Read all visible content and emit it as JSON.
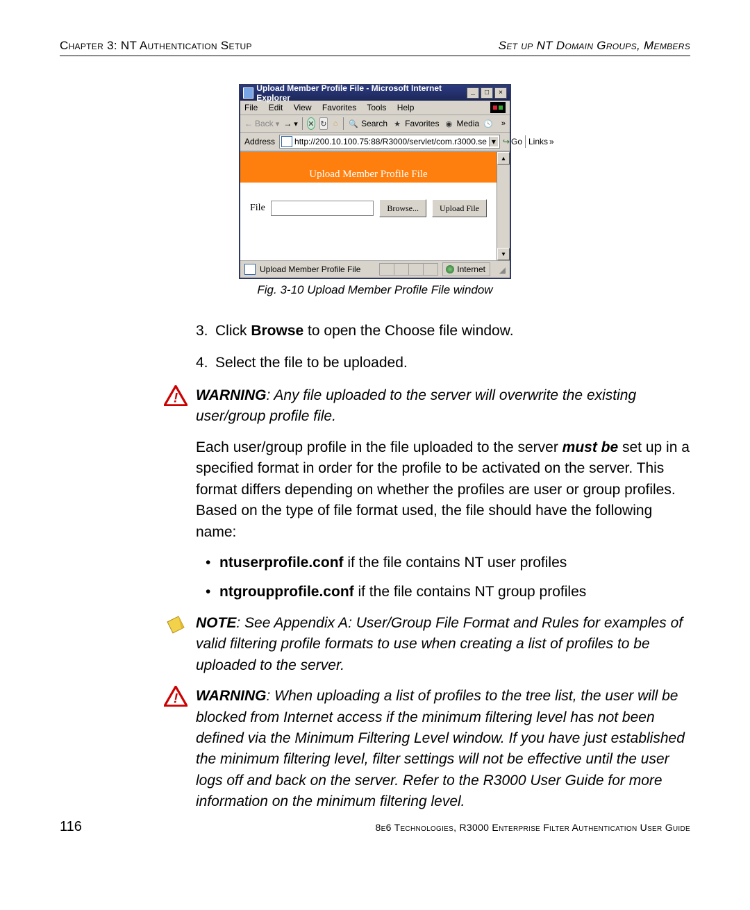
{
  "header": {
    "left_prefix": "Chapter 3: NT Authentication Setup",
    "right": "Set up NT Domain Groups, Members"
  },
  "ie_window": {
    "title": "Upload Member Profile File - Microsoft Internet Explorer",
    "menu": {
      "file": "File",
      "edit": "Edit",
      "view": "View",
      "favorites": "Favorites",
      "tools": "Tools",
      "help": "Help"
    },
    "toolbar": {
      "back": "Back",
      "search": "Search",
      "favorites": "Favorites",
      "media": "Media"
    },
    "address": {
      "label": "Address",
      "url": "http://200.10.100.75:88/R3000/servlet/com.r3000.se",
      "go": "Go",
      "links": "Links"
    },
    "content": {
      "banner": "Upload Member Profile File",
      "file_label": "File",
      "browse_btn": "Browse...",
      "upload_btn": "Upload File"
    },
    "status": {
      "text": "Upload Member Profile File",
      "zone": "Internet"
    }
  },
  "figure_caption": "Fig. 3-10  Upload Member Profile File window",
  "steps": {
    "s3": {
      "num": "3.",
      "pre": "Click ",
      "bold": "Browse",
      "post": " to open the Choose file window."
    },
    "s4": {
      "num": "4.",
      "text": "Select the file to be uploaded."
    }
  },
  "warn1": {
    "label": "WARNING",
    "text": ": Any file uploaded to the server will overwrite the existing user/group profile file."
  },
  "para1": {
    "pre": "Each user/group profile in the file uploaded to the server ",
    "bold": "must be",
    "post": " set up in a specified format in order for the profile to be activated on the server. This format differs depending on whether the profiles are user or group profiles. Based on the type of file format used, the file should have the following name:"
  },
  "bullets": {
    "b1": {
      "bold": "ntuserprofile.conf",
      "post": " if the file contains NT user profiles"
    },
    "b2": {
      "bold": "ntgroupprofile.conf",
      "post": " if the file contains NT group profiles"
    }
  },
  "note1": {
    "label": "NOTE",
    "text": ": See Appendix A: User/Group File Format and Rules for examples of valid filtering profile formats to use when creating a list of profiles to be uploaded to the server."
  },
  "warn2": {
    "label": "WARNING",
    "text": ": When uploading a list of profiles to the tree list, the user will be blocked from Internet access if the minimum filtering level has not been defined via the Minimum Filtering Level window. If you have just established the minimum filtering level, filter settings will not be effective until the user logs off and back on the server. Refer to the R3000 User Guide for more information on the minimum filtering level."
  },
  "footer": {
    "page": "116",
    "right": "8e6 Technologies, R3000 Enterprise Filter Authentication User Guide"
  }
}
